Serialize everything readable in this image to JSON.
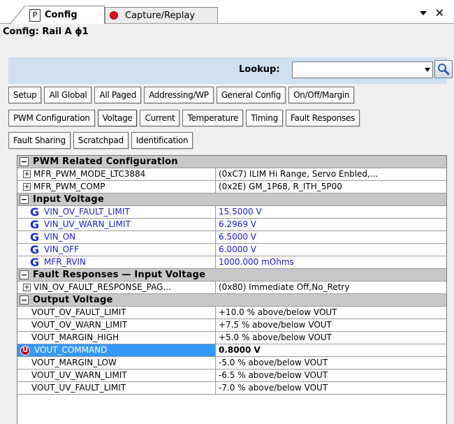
{
  "tabs": {
    "config_label": "Config",
    "config_prefix": "P",
    "capture_label": "Capture/Replay"
  },
  "header": {
    "title": "Config: Rail A ϕ1"
  },
  "lookup": {
    "label": "Lookup:",
    "value": ""
  },
  "buttons": {
    "row1": [
      "Setup",
      "All Global",
      "All Paged",
      "Addressing/WP",
      "General Config",
      "On/Off/Margin"
    ],
    "row2": [
      "PWM Configuration",
      "Voltage",
      "Current",
      "Temperature",
      "Timing",
      "Fault Responses"
    ],
    "row3": [
      "Fault Sharing",
      "Scratchpad",
      "Identification"
    ],
    "active": "Voltage"
  },
  "grid": {
    "categories": {
      "pwm": "PWM Related Configuration",
      "input": "Input Voltage",
      "fault_input": "Fault Responses — Input Voltage",
      "output": "Output Voltage"
    },
    "pwm_rows": [
      {
        "name": "MFR_PWM_MODE_LTC3884",
        "value": "(0xC7) ILIM Hi Range, Servo Enbled,..."
      },
      {
        "name": "MFR_PWM_COMP",
        "value": "(0x2E) GM_1P68, R_ITH_5P00"
      }
    ],
    "input_rows": [
      {
        "name": "VIN_OV_FAULT_LIMIT",
        "value": "15.5000 V"
      },
      {
        "name": "VIN_UV_WARN_LIMIT",
        "value": "6.2969 V"
      },
      {
        "name": "VIN_ON",
        "value": "6.5000 V"
      },
      {
        "name": "VIN_OFF",
        "value": "6.0000 V"
      },
      {
        "name": "MFR_RVIN",
        "value": "1000.000 mOhms"
      }
    ],
    "fault_input_rows": [
      {
        "name": "VIN_OV_FAULT_RESPONSE_PAG...",
        "value": "(0x80) Immediate Off,No_Retry"
      }
    ],
    "output_rows": [
      {
        "name": "VOUT_OV_FAULT_LIMIT",
        "value": "+10.0 % above/below VOUT"
      },
      {
        "name": "VOUT_OV_WARN_LIMIT",
        "value": "+7.5 % above/below VOUT"
      },
      {
        "name": "VOUT_MARGIN_HIGH",
        "value": "+5.0 % above/below VOUT"
      },
      {
        "name": "VOUT_COMMAND",
        "value": "0.8000 V"
      },
      {
        "name": "VOUT_MARGIN_LOW",
        "value": "-5.0 % above/below VOUT"
      },
      {
        "name": "VOUT_UV_WARN_LIMIT",
        "value": "-6.5 % above/below VOUT"
      },
      {
        "name": "VOUT_UV_FAULT_LIMIT",
        "value": "-7.0 % above/below VOUT"
      }
    ],
    "global_marker": "G",
    "user_marker": "U"
  },
  "colors": {
    "lookup_bar": "#cfe0f1",
    "selected": "#3399ff",
    "global_text": "#1a1acc",
    "record": "#e0101a"
  }
}
